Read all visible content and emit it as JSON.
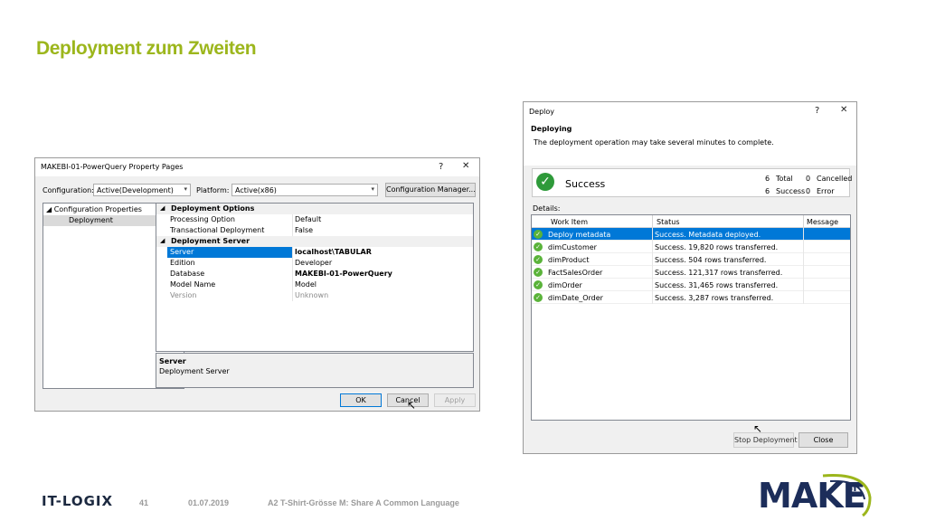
{
  "slide": {
    "title": "Deployment zum Zweiten",
    "footer_logo": "IT-LOGIX",
    "page_number": "41",
    "date": "01.07.2019",
    "subtitle": "A2 T-Shirt-Grösse M: Share A Common Language",
    "brand_logo": "MAKE",
    "brand_logo_suffix": "BI",
    "brand_color": "#9cb61c"
  },
  "property_dialog": {
    "title": "MAKEBI-01-PowerQuery Property Pages",
    "help": "?",
    "close": "✕",
    "configuration_label": "Configuration:",
    "configuration_value": "Active(Development)",
    "platform_label": "Platform:",
    "platform_value": "Active(x86)",
    "config_manager": "Configuration Manager...",
    "tree": {
      "parent": "Configuration Properties",
      "child": "Deployment"
    },
    "grid": {
      "cat1": "Deployment Options",
      "rows1": [
        {
          "name": "Processing Option",
          "value": "Default"
        },
        {
          "name": "Transactional Deployment",
          "value": "False"
        }
      ],
      "cat2": "Deployment Server",
      "rows2": [
        {
          "name": "Server",
          "value": "localhost\\TABULAR"
        },
        {
          "name": "Edition",
          "value": "Developer"
        },
        {
          "name": "Database",
          "value": "MAKEBI-01-PowerQuery"
        },
        {
          "name": "Model Name",
          "value": "Model"
        },
        {
          "name": "Version",
          "value": "Unknown"
        }
      ]
    },
    "desc_title": "Server",
    "desc_text": "Deployment Server",
    "ok": "OK",
    "cancel": "Cancel",
    "apply": "Apply"
  },
  "deploy_dialog": {
    "title": "Deploy",
    "help": "?",
    "close": "✕",
    "heading": "Deploying",
    "subheading": "The deployment operation may take several minutes to complete.",
    "status": "Success",
    "total_count": "6",
    "total_label": "Total",
    "cancelled_count": "0",
    "cancelled_label": "Cancelled",
    "success_count": "6",
    "success_label": "Success",
    "error_count": "0",
    "error_label": "Error",
    "details_label": "Details:",
    "columns": [
      "Work Item",
      "Status",
      "Message"
    ],
    "rows": [
      {
        "item": "Deploy metadata",
        "status": "Success. Metadata deployed."
      },
      {
        "item": "dimCustomer",
        "status": "Success. 19,820 rows transferred."
      },
      {
        "item": "dimProduct",
        "status": "Success. 504 rows transferred."
      },
      {
        "item": "FactSalesOrder",
        "status": "Success. 121,317 rows transferred."
      },
      {
        "item": "dimOrder",
        "status": "Success. 31,465 rows transferred."
      },
      {
        "item": "dimDate_Order",
        "status": "Success. 3,287 rows transferred."
      }
    ],
    "stop": "Stop Deployment",
    "close_btn": "Close"
  }
}
